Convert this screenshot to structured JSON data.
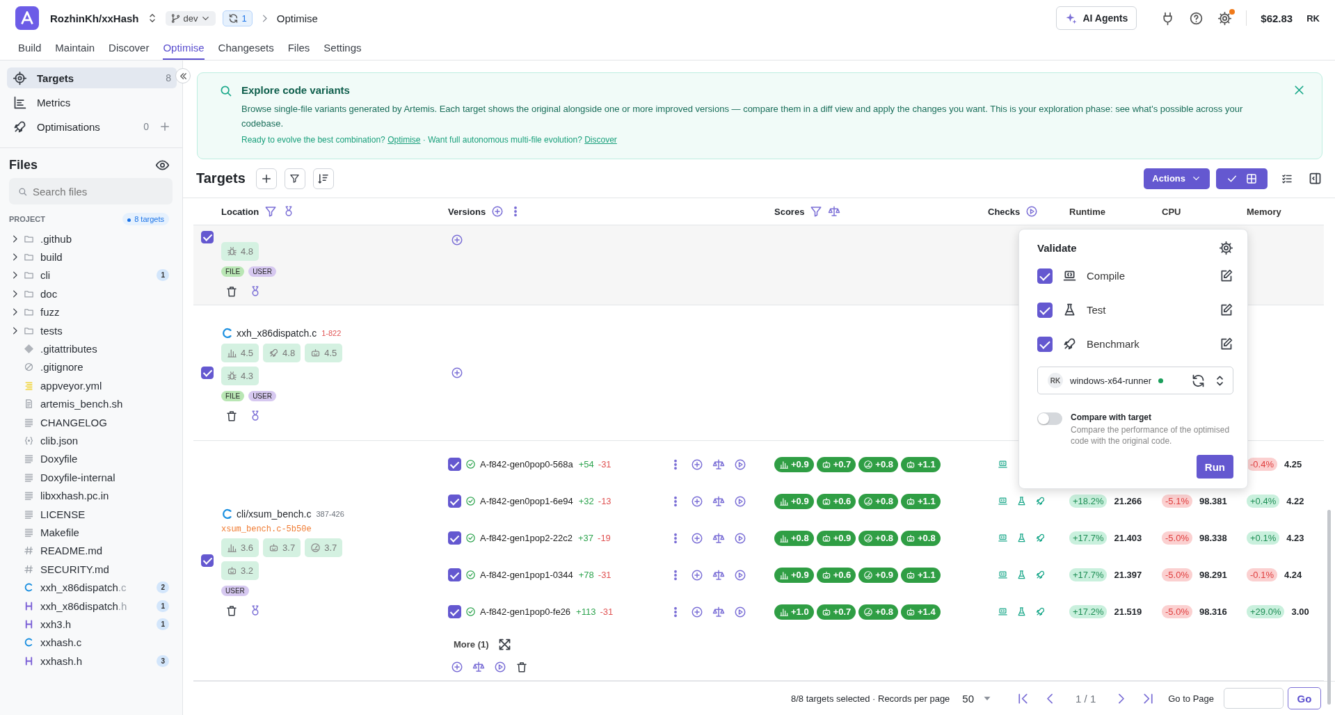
{
  "header": {
    "repo": "RozhinKh/xxHash",
    "branch": "dev",
    "sync_count": "1",
    "breadcrumb": "Optimise",
    "ai_button": "AI Agents",
    "settings_alert": true,
    "balance": "$62.83",
    "user_initials": "RK"
  },
  "nav_tabs": [
    {
      "label": "Build",
      "selected": false
    },
    {
      "label": "Maintain",
      "selected": false
    },
    {
      "label": "Discover",
      "selected": false
    },
    {
      "label": "Optimise",
      "selected": true
    },
    {
      "label": "Changesets",
      "selected": false
    },
    {
      "label": "Files",
      "selected": false
    },
    {
      "label": "Settings",
      "selected": false
    }
  ],
  "sidebar": {
    "items": [
      {
        "label": "Targets",
        "kind": "crosshair",
        "count": "8",
        "add": false,
        "selected": true
      },
      {
        "label": "Metrics",
        "kind": "metrics",
        "add": false,
        "selected": false
      },
      {
        "label": "Optimisations",
        "kind": "rocket",
        "count": "0",
        "add": true,
        "selected": false
      }
    ],
    "files_title": "Files",
    "search_placeholder": "Search files",
    "section": "PROJECT",
    "targets_badge": "8 targets",
    "tree": [
      {
        "name": ".github",
        "kind": "folder",
        "expanded": false
      },
      {
        "name": "build",
        "kind": "folder",
        "expanded": false
      },
      {
        "name": "cli",
        "kind": "folder",
        "expanded": false,
        "count": "1"
      },
      {
        "name": "doc",
        "kind": "folder",
        "expanded": false
      },
      {
        "name": "fuzz",
        "kind": "folder",
        "expanded": false
      },
      {
        "name": "tests",
        "kind": "folder",
        "expanded": false
      },
      {
        "name": ".gitattributes",
        "kind": "git"
      },
      {
        "name": ".gitignore",
        "kind": "ignore"
      },
      {
        "name": "appveyor.yml",
        "kind": "yaml"
      },
      {
        "name": "artemis_bench.sh",
        "kind": "script"
      },
      {
        "name": "CHANGELOG",
        "kind": "text"
      },
      {
        "name": "clib.json",
        "kind": "json"
      },
      {
        "name": "Doxyfile",
        "kind": "text"
      },
      {
        "name": "Doxyfile-internal",
        "kind": "text"
      },
      {
        "name": "libxxhash.pc.in",
        "kind": "text"
      },
      {
        "name": "LICENSE",
        "kind": "text"
      },
      {
        "name": "Makefile",
        "kind": "text"
      },
      {
        "name": "README.md",
        "kind": "hash"
      },
      {
        "name": "SECURITY.md",
        "kind": "hash"
      },
      {
        "name": "xxh_x86dispatch",
        "ext": ".c",
        "kind": "c",
        "count": "2"
      },
      {
        "name": "xxh_x86dispatch",
        "ext": ".h",
        "kind": "h",
        "count": "1"
      },
      {
        "name": "xxh3.h",
        "kind": "h",
        "count": "1"
      },
      {
        "name": "xxhash.c",
        "kind": "c"
      },
      {
        "name": "xxhash.h",
        "kind": "h",
        "count": "3"
      }
    ]
  },
  "banner": {
    "title": "Explore code variants",
    "body": "Browse single-file variants generated by Artemis. Each target shows the original alongside one or more improved versions — compare them in a diff view and apply the changes you want. This is your exploration phase: see what's possible across your codebase.",
    "footer": [
      {
        "kind": "text",
        "text": "Ready to evolve the best combination? "
      },
      {
        "kind": "link",
        "text": "Optimise"
      },
      {
        "kind": "text",
        "text": " · Want full autonomous multi-file evolution? "
      },
      {
        "kind": "link",
        "text": "Discover"
      }
    ]
  },
  "toolbar": {
    "title": "Targets",
    "actions": "Actions",
    "views": [
      {
        "kind": "check-grid",
        "selected": true
      },
      {
        "kind": "list",
        "selected": false
      }
    ]
  },
  "columns": [
    {
      "label": "Location",
      "icons": [
        {
          "kind": "filter"
        },
        {
          "kind": "medal"
        }
      ]
    },
    {
      "label": "Versions",
      "icons": [
        {
          "kind": "plus"
        },
        {
          "kind": "dots"
        }
      ]
    },
    {
      "label": "Scores",
      "icons": [
        {
          "kind": "filter"
        },
        {
          "kind": "scale"
        }
      ]
    },
    {
      "label": "Checks",
      "icons": [
        {
          "kind": "play"
        }
      ]
    },
    {
      "label": "Runtime"
    },
    {
      "label": "CPU"
    },
    {
      "label": "Memory"
    }
  ],
  "rows": [
    {
      "checked": true,
      "chips": [
        {
          "kind": "bug",
          "value": "4.8"
        }
      ],
      "tags": [
        {
          "label": "FILE",
          "color": "#b9e6b4"
        },
        {
          "label": "USER",
          "color": "#d6c8f0"
        }
      ],
      "versions": []
    },
    {
      "checked": true,
      "file": "xxh_x86dispatch.c",
      "range": "1-822",
      "chips": [
        {
          "kind": "chart",
          "value": "4.5"
        },
        {
          "kind": "rocket",
          "value": "4.8"
        },
        {
          "kind": "robot",
          "value": "4.5"
        },
        {
          "kind": "bug",
          "value": "4.3"
        }
      ],
      "tags": [
        {
          "label": "FILE",
          "color": "#b9e6b4"
        },
        {
          "label": "USER",
          "color": "#d6c8f0"
        }
      ],
      "versions": []
    },
    {
      "checked": true,
      "file": "cli/xsum_bench.c",
      "range": "387-426",
      "variant": "xsum_bench.c-5b50e",
      "chips": [
        {
          "kind": "chart",
          "value": "3.6"
        },
        {
          "kind": "robot",
          "value": "3.7"
        },
        {
          "kind": "gauge",
          "value": "3.7"
        },
        {
          "kind": "robot",
          "value": "3.2"
        }
      ],
      "tags": [
        {
          "label": "USER",
          "color": "#d6c8f0"
        }
      ],
      "versions": [
        {
          "name": "A-f842-gen0pop0-568a",
          "added": "+54",
          "removed": "-31",
          "checked": true,
          "passed": true,
          "scores": [
            {
              "kind": "chart",
              "value": "+0.9"
            },
            {
              "kind": "robot",
              "value": "+0.7"
            },
            {
              "kind": "gauge",
              "value": "+0.8"
            },
            {
              "kind": "robot",
              "value": "+1.1"
            }
          ],
          "checks": [
            {
              "kind": "compile"
            }
          ],
          "memory": {
            "delta": "-0.4%",
            "good": false,
            "value": "4.25"
          }
        },
        {
          "name": "A-f842-gen0pop1-6e94",
          "added": "+32",
          "removed": "-13",
          "checked": true,
          "passed": true,
          "scores": [
            {
              "kind": "chart",
              "value": "+0.9"
            },
            {
              "kind": "robot",
              "value": "+0.6"
            },
            {
              "kind": "gauge",
              "value": "+0.8"
            },
            {
              "kind": "robot",
              "value": "+1.1"
            }
          ],
          "checks": [
            {
              "kind": "compile"
            },
            {
              "kind": "test"
            },
            {
              "kind": "benchmark"
            }
          ],
          "runtime": {
            "delta": "+18.2%",
            "good": true,
            "value": "21.266"
          },
          "cpu": {
            "delta": "-5.1%",
            "good": false,
            "value": "98.381"
          },
          "memory": {
            "delta": "+0.4%",
            "good": true,
            "value": "4.22"
          }
        },
        {
          "name": "A-f842-gen1pop2-22c2",
          "added": "+37",
          "removed": "-19",
          "checked": true,
          "passed": true,
          "scores": [
            {
              "kind": "chart",
              "value": "+0.8"
            },
            {
              "kind": "robot",
              "value": "+0.9"
            },
            {
              "kind": "gauge",
              "value": "+0.8"
            },
            {
              "kind": "robot",
              "value": "+0.8"
            }
          ],
          "checks": [
            {
              "kind": "compile"
            },
            {
              "kind": "test"
            },
            {
              "kind": "benchmark"
            }
          ],
          "runtime": {
            "delta": "+17.7%",
            "good": true,
            "value": "21.403"
          },
          "cpu": {
            "delta": "-5.0%",
            "good": false,
            "value": "98.338"
          },
          "memory": {
            "delta": "+0.1%",
            "good": true,
            "value": "4.23"
          }
        },
        {
          "name": "A-f842-gen1pop1-0344",
          "added": "+78",
          "removed": "-31",
          "checked": true,
          "passed": true,
          "scores": [
            {
              "kind": "chart",
              "value": "+0.9"
            },
            {
              "kind": "robot",
              "value": "+0.6"
            },
            {
              "kind": "gauge",
              "value": "+0.9"
            },
            {
              "kind": "robot",
              "value": "+1.1"
            }
          ],
          "checks": [
            {
              "kind": "compile"
            },
            {
              "kind": "test"
            },
            {
              "kind": "benchmark"
            }
          ],
          "runtime": {
            "delta": "+17.7%",
            "good": true,
            "value": "21.397"
          },
          "cpu": {
            "delta": "-5.0%",
            "good": false,
            "value": "98.291"
          },
          "memory": {
            "delta": "-0.1%",
            "good": false,
            "value": "4.24"
          }
        },
        {
          "name": "A-f842-gen1pop0-fe26",
          "added": "+113",
          "removed": "-31",
          "checked": true,
          "passed": true,
          "scores": [
            {
              "kind": "chart",
              "value": "+1.0"
            },
            {
              "kind": "robot",
              "value": "+0.7"
            },
            {
              "kind": "gauge",
              "value": "+0.8"
            },
            {
              "kind": "robot",
              "value": "+1.4"
            }
          ],
          "checks": [
            {
              "kind": "compile"
            },
            {
              "kind": "test"
            },
            {
              "kind": "benchmark"
            }
          ],
          "runtime": {
            "delta": "+17.2%",
            "good": true,
            "value": "21.519"
          },
          "cpu": {
            "delta": "-5.0%",
            "good": false,
            "value": "98.316"
          },
          "memory": {
            "delta": "+29.0%",
            "good": true,
            "value": "3.00"
          }
        }
      ],
      "more": "More (1)"
    }
  ],
  "validate": {
    "title": "Validate",
    "items": [
      {
        "label": "Compile",
        "kind": "compile",
        "checked": true
      },
      {
        "label": "Test",
        "kind": "test",
        "checked": true
      },
      {
        "label": "Benchmark",
        "kind": "benchmark",
        "checked": true
      }
    ],
    "runner": {
      "initials": "RK",
      "name": "windows-x64-runner",
      "online": true
    },
    "toggle": {
      "label": "Compare with target",
      "description": "Compare the performance of the optimised code with the original code.",
      "on": false
    },
    "run": "Run"
  },
  "footer": {
    "summary": "8/8 targets selected · Records per page",
    "per_page": "50",
    "page": "1 / 1",
    "goto_label": "Go to Page",
    "go": "Go"
  }
}
